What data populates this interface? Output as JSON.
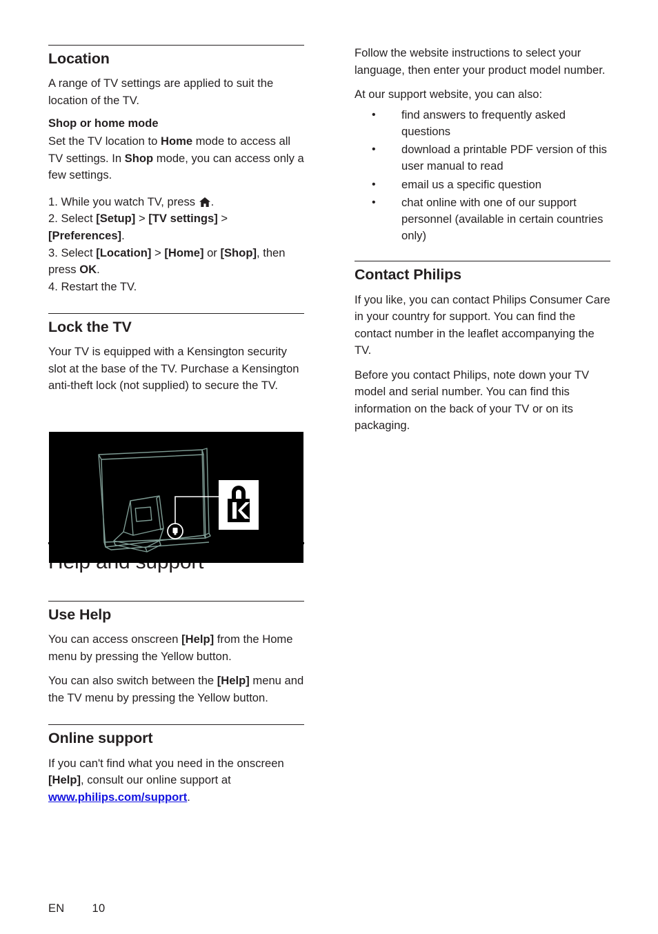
{
  "document": {
    "language_code": "EN",
    "page_number": "10",
    "link_color": "#1414e0",
    "text_color": "#231f20",
    "illustration_stroke_color": "#7f9d95"
  },
  "left_column": {
    "location": {
      "heading": "Location",
      "intro": "A range of TV settings are applied to suit the location of the TV.",
      "subheading": "Shop or home mode",
      "sub_body_1": "Set the TV location to ",
      "sub_body_bold_1": "Home",
      "sub_body_2": " mode to access all TV settings. In ",
      "sub_body_bold_2": "Shop",
      "sub_body_3": " mode, you can access only a few settings.",
      "steps": [
        {
          "number": "1.",
          "parts": [
            {
              "text": "While you watch TV, press ",
              "style": "normal"
            },
            {
              "text": "home-icon",
              "style": "icon"
            },
            {
              "text": ".",
              "style": "normal"
            }
          ]
        },
        {
          "number": "2.",
          "parts": [
            {
              "text": "Select ",
              "style": "normal"
            },
            {
              "text": "[Setup]",
              "style": "bold"
            },
            {
              "text": " > ",
              "style": "normal"
            },
            {
              "text": "[TV settings]",
              "style": "bold"
            },
            {
              "text": " > ",
              "style": "normal"
            },
            {
              "text": "[Preferences]",
              "style": "bold"
            },
            {
              "text": ".",
              "style": "normal"
            }
          ]
        },
        {
          "number": "3.",
          "parts": [
            {
              "text": "Select ",
              "style": "normal"
            },
            {
              "text": "[Location]",
              "style": "bold"
            },
            {
              "text": " > ",
              "style": "normal"
            },
            {
              "text": "[Home]",
              "style": "bold"
            },
            {
              "text": " or ",
              "style": "normal"
            },
            {
              "text": "[Shop]",
              "style": "bold"
            },
            {
              "text": ", then press ",
              "style": "normal"
            },
            {
              "text": "OK",
              "style": "bold"
            },
            {
              "text": ".",
              "style": "normal"
            }
          ]
        },
        {
          "number": "4.",
          "parts": [
            {
              "text": "Restart the TV.",
              "style": "normal"
            }
          ]
        }
      ]
    },
    "lock_the_tv": {
      "heading": "Lock the TV",
      "body": "Your TV is equipped with a Kensington security slot at the base of the TV. Purchase a Kensington anti-theft lock (not supplied) to secure the TV.",
      "illustration_alt": "Rear view of a TV on a stand with a callout to the Kensington security slot and the Kensington padlock logo"
    },
    "help_and_support": {
      "title": "Help and support"
    },
    "use_help": {
      "heading": "Use Help",
      "para_1_a": "You can access onscreen ",
      "para_1_bold": "[Help]",
      "para_1_b": " from the Home menu by pressing the Yellow button.",
      "para_2_a": "You can also switch between the ",
      "para_2_bold": "[Help]",
      "para_2_b": " menu and the TV menu by pressing the Yellow button."
    },
    "online_support": {
      "heading": "Online support",
      "para_a": "If you can't find what you need in the onscreen ",
      "para_bold": "[Help]",
      "para_b": ", consult our online support at ",
      "link_text": "www.philips.com/support",
      "para_c": "."
    }
  },
  "right_column": {
    "intro_para_1": "Follow the website instructions to select your language, then enter your product model number.",
    "intro_para_2": "At our support website, you can also:",
    "bullets": [
      "find answers to frequently asked questions",
      "download a printable PDF version of this user manual to read",
      "email us a specific question",
      "chat online with one of our support personnel (available in certain countries only)"
    ],
    "contact_philips": {
      "heading": "Contact Philips",
      "para_1": "If you like, you can contact Philips Consumer Care in your country for support. You can find the contact number in the leaflet accompanying the TV.",
      "para_2": "Before you contact Philips, note down your TV model and serial number. You can find this information on the back of your TV or on its packaging."
    }
  }
}
